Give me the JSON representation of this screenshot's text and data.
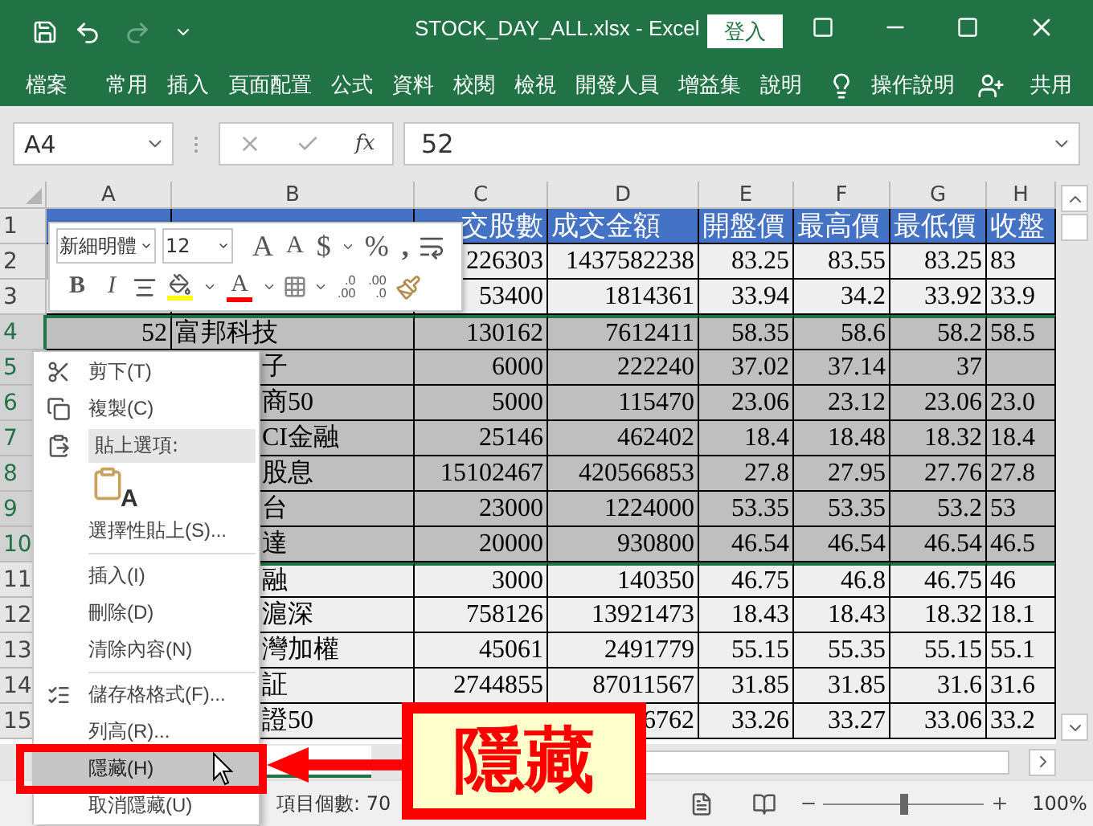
{
  "window": {
    "title": "STOCK_DAY_ALL.xlsx  -  Excel",
    "sign_in": "登入"
  },
  "quick_access": {
    "redo_disabled": true
  },
  "ribbon": {
    "tabs": [
      "檔案",
      "常用",
      "插入",
      "頁面配置",
      "公式",
      "資料",
      "校閱",
      "檢視",
      "開發人員",
      "增益集",
      "說明"
    ],
    "tell_me": "操作說明",
    "share": "共用"
  },
  "formula_bar": {
    "name_box": "A4",
    "function_label": "fx",
    "value": "52"
  },
  "columns": [
    "A",
    "B",
    "C",
    "D",
    "E",
    "F",
    "G",
    "H"
  ],
  "rows": [
    {
      "number": "1",
      "kind": "header",
      "selected": false,
      "cells": {
        "c": "交股數",
        "d": "成交金額",
        "e": "開盤價",
        "f": "最高價",
        "g": "最低價",
        "h": "收盤"
      }
    },
    {
      "number": "2",
      "kind": "data",
      "selected": false,
      "cells": {
        "c": "226303",
        "d": "1437582238",
        "e": "83.25",
        "f": "83.55",
        "g": "83.25",
        "h": "83"
      }
    },
    {
      "number": "3",
      "kind": "data",
      "selected": false,
      "cells": {
        "c": "53400",
        "d": "1814361",
        "e": "33.94",
        "f": "34.2",
        "g": "33.92",
        "h": "33.9"
      }
    },
    {
      "number": "4",
      "kind": "data",
      "selected": true,
      "cells": {
        "a": "52",
        "b": "富邦科技",
        "c": "130162",
        "d": "7612411",
        "e": "58.35",
        "f": "58.6",
        "g": "58.2",
        "h": "58.5"
      }
    },
    {
      "number": "5",
      "kind": "data",
      "selected": true,
      "cells": {
        "b": "子",
        "c": "6000",
        "d": "222240",
        "e": "37.02",
        "f": "37.14",
        "g": "37"
      }
    },
    {
      "number": "6",
      "kind": "data",
      "selected": true,
      "cells": {
        "b": "商50",
        "c": "5000",
        "d": "115470",
        "e": "23.06",
        "f": "23.12",
        "g": "23.06",
        "h": "23.0"
      }
    },
    {
      "number": "7",
      "kind": "data",
      "selected": true,
      "cells": {
        "b": "CI金融",
        "c": "25146",
        "d": "462402",
        "e": "18.4",
        "f": "18.48",
        "g": "18.32",
        "h": "18.4"
      }
    },
    {
      "number": "8",
      "kind": "data",
      "selected": true,
      "cells": {
        "b": "股息",
        "c": "15102467",
        "d": "420566853",
        "e": "27.8",
        "f": "27.95",
        "g": "27.76",
        "h": "27.8"
      }
    },
    {
      "number": "9",
      "kind": "data",
      "selected": true,
      "cells": {
        "b": "台",
        "c": "23000",
        "d": "1224000",
        "e": "53.35",
        "f": "53.35",
        "g": "53.2",
        "h": "53"
      }
    },
    {
      "number": "10",
      "kind": "data",
      "selected": true,
      "cells": {
        "b": "達",
        "c": "20000",
        "d": "930800",
        "e": "46.54",
        "f": "46.54",
        "g": "46.54",
        "h": "46.5"
      }
    },
    {
      "number": "11",
      "kind": "data",
      "selected": false,
      "cells": {
        "b": "融",
        "c": "3000",
        "d": "140350",
        "e": "46.75",
        "f": "46.8",
        "g": "46.75",
        "h": "46"
      }
    },
    {
      "number": "12",
      "kind": "data",
      "selected": false,
      "cells": {
        "b": "滬深",
        "c": "758126",
        "d": "13921473",
        "e": "18.43",
        "f": "18.43",
        "g": "18.32",
        "h": "18.1"
      }
    },
    {
      "number": "13",
      "kind": "data",
      "selected": false,
      "cells": {
        "b": "灣加權",
        "c": "45061",
        "d": "2491779",
        "e": "55.15",
        "f": "55.35",
        "g": "55.15",
        "h": "55.1"
      }
    },
    {
      "number": "14",
      "kind": "data",
      "selected": false,
      "cells": {
        "b": "証",
        "c": "2744855",
        "d": "87011567",
        "e": "31.85",
        "f": "31.85",
        "g": "31.6",
        "h": "31.6"
      }
    },
    {
      "number": "15",
      "kind": "data",
      "selected": false,
      "cells": {
        "b": "證50",
        "d": "6762",
        "e": "33.26",
        "f": "33.27",
        "g": "33.06",
        "h": "33.2"
      }
    }
  ],
  "mini_toolbar": {
    "font": "新細明體",
    "size": "12",
    "grow_font": "A",
    "shrink_font": "A",
    "currency": "$",
    "percent": "%",
    "comma": ",",
    "bold": "B",
    "italic": "I",
    "font_color": "A",
    "increase_decimal": {
      "top": ".0",
      "bottom": ".00"
    },
    "decrease_decimal": {
      "top": ".00",
      "bottom": ".0"
    }
  },
  "context_menu": [
    {
      "kind": "item",
      "label": "剪下(T)",
      "selected": false
    },
    {
      "kind": "item",
      "label": "複製(C)",
      "selected": false
    },
    {
      "kind": "header",
      "label": "貼上選項:"
    },
    {
      "kind": "paste_option",
      "label": "A",
      "selected": false
    },
    {
      "kind": "item",
      "label": "選擇性貼上(S)...",
      "selected": false
    },
    {
      "kind": "separator"
    },
    {
      "kind": "item",
      "label": "插入(I)",
      "selected": false
    },
    {
      "kind": "item",
      "label": "刪除(D)",
      "selected": false
    },
    {
      "kind": "item",
      "label": "清除內容(N)",
      "selected": false
    },
    {
      "kind": "separator"
    },
    {
      "kind": "item",
      "label": "儲存格格式(F)...",
      "selected": false
    },
    {
      "kind": "item",
      "label": "列高(R)...",
      "selected": false
    },
    {
      "kind": "item",
      "label": "隱藏(H)",
      "selected": true
    },
    {
      "kind": "item",
      "label": "取消隱藏(U)",
      "selected": false
    }
  ],
  "status_bar": {
    "summary": "項目個數: 70",
    "zoom": {
      "label": "100%",
      "level": 0.5
    }
  },
  "annotation": {
    "callout": "隱藏"
  }
}
